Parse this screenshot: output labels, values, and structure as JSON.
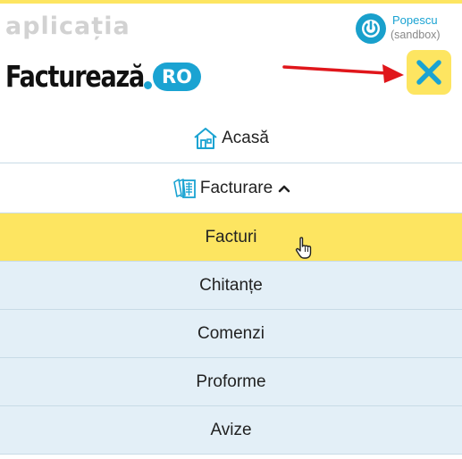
{
  "header": {
    "watermark": "aplicația",
    "user_name": "Popescu",
    "user_env": "(sandbox)",
    "logo_text": "Facturează",
    "logo_badge": "RO",
    "close_icon": "close-x-icon",
    "power_icon": "power-icon"
  },
  "menu": {
    "home": {
      "label": "Acasă",
      "icon": "house-icon"
    },
    "billing": {
      "label": "Facturare",
      "icon": "documents-icon",
      "expanded": true
    },
    "submenu": [
      {
        "label": "Facturi",
        "active": true
      },
      {
        "label": "Chitanțe"
      },
      {
        "label": "Comenzi"
      },
      {
        "label": "Proforme"
      },
      {
        "label": "Avize"
      }
    ]
  },
  "colors": {
    "accent_yellow": "#fde561",
    "brand_blue": "#1aa3d2",
    "submenu_bg": "#e3eff7",
    "arrow_red": "#e0161b"
  }
}
